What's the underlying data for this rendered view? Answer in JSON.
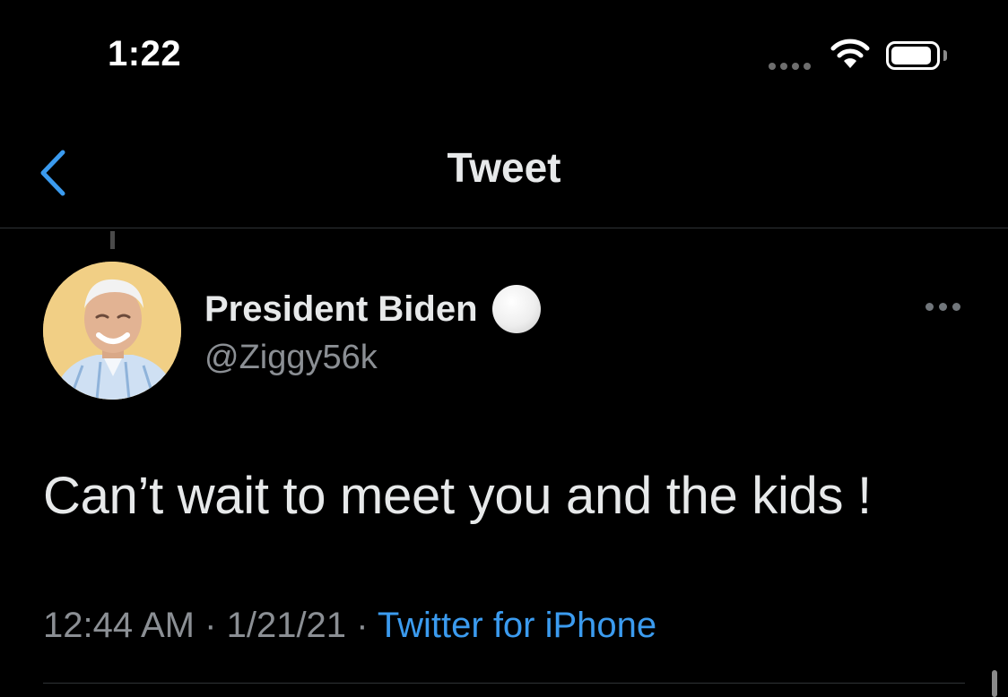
{
  "status_bar": {
    "time": "1:22"
  },
  "nav": {
    "title": "Tweet"
  },
  "tweet": {
    "display_name": "President Biden",
    "handle": "@Ziggy56k",
    "text": "Can’t wait to meet you and the kids !",
    "time": "12:44 AM",
    "separator": "·",
    "date": "1/21/21",
    "source": "Twitter for iPhone"
  },
  "colors": {
    "background": "#000000",
    "text": "#e7e9ea",
    "muted": "#8b8f94",
    "link": "#3b9bef",
    "divider": "#2f3336"
  },
  "icons": [
    "signal-dots-icon",
    "wifi-icon",
    "battery-icon",
    "back-chevron-icon",
    "verified-dot-icon",
    "more-options-icon"
  ]
}
